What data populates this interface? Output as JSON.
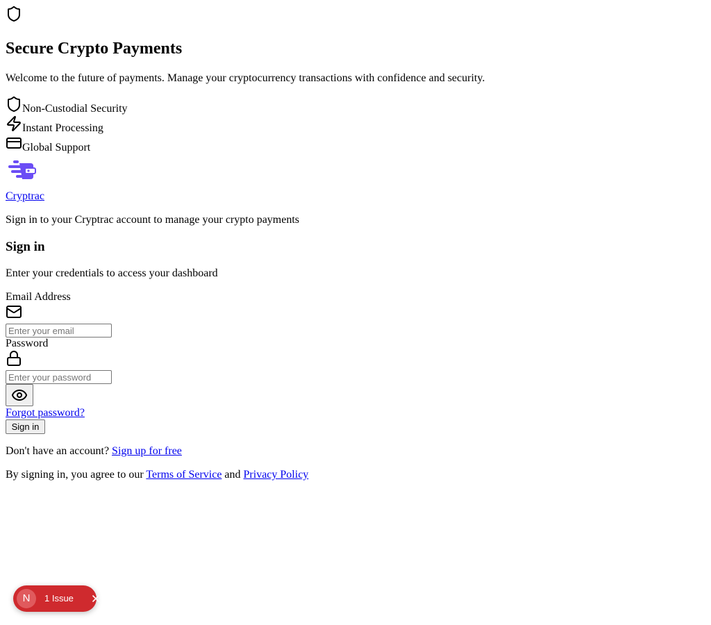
{
  "hero": {
    "title": "Secure Crypto Payments",
    "description": "Welcome to the future of payments. Manage your cryptocurrency transactions with confidence and security.",
    "features": [
      {
        "label": "Non-Custodial Security",
        "icon": "shield-icon"
      },
      {
        "label": "Instant Processing",
        "icon": "lightning-icon"
      },
      {
        "label": "Global Support",
        "icon": "credit-card-icon"
      }
    ]
  },
  "brand": {
    "name": "Cryptrac",
    "tagline": "Sign in to your Cryptrac account to manage your crypto payments",
    "logo_color": "#6b4df5"
  },
  "signin": {
    "heading": "Sign in",
    "subheading": "Enter your credentials to access your dashboard",
    "email_label": "Email Address",
    "email_placeholder": "Enter your email",
    "password_label": "Password",
    "password_placeholder": "Enter your password",
    "forgot_password": "Forgot password?",
    "submit_label": "Sign in",
    "no_account_text": "Don't have an account?",
    "signup_link": "Sign up for free",
    "agree_text": "By signing in, you agree to our",
    "terms_link": "Terms of Service",
    "and_text": "and",
    "privacy_link": "Privacy Policy"
  },
  "dev_overlay": {
    "badge_letter": "N",
    "issues_label": "1 Issue",
    "background_color": "#cf2a2e"
  }
}
